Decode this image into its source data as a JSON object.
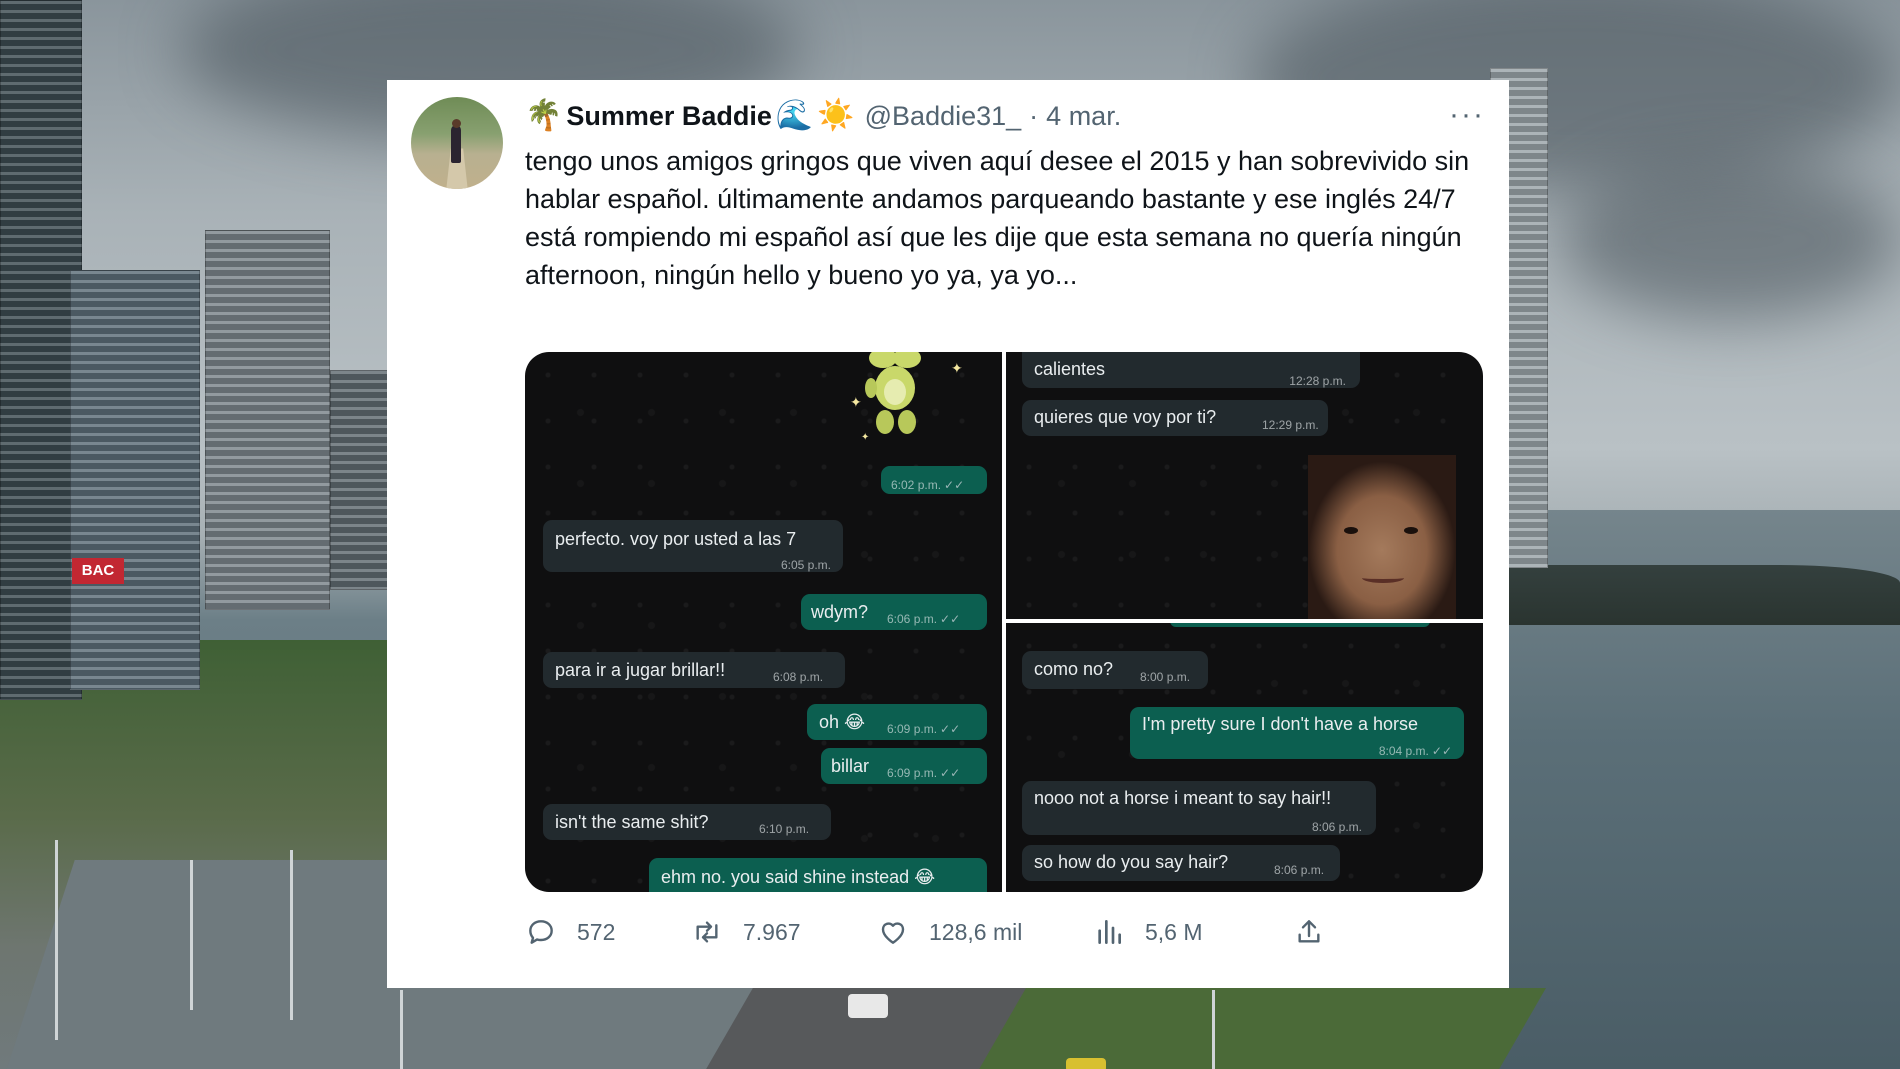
{
  "background": {
    "bank_sign": "BAC"
  },
  "tweet": {
    "display_name": "Summer Baddie",
    "emoji_prefix": "🌴",
    "emoji_suffix_1": "🌊",
    "emoji_suffix_2": "☀️",
    "handle": "@Baddie31_",
    "separator": "·",
    "date": "4 mar.",
    "more_label": "···",
    "text": "tengo unos amigos gringos que viven aquí desee el 2015 y han sobrevivido sin hablar español. últimamente andamos parqueando bastante y ese inglés 24/7 está rompiendo mi español así que les dije que esta semana no quería ningún afternoon, ningún hello y bueno yo ya, ya yo..."
  },
  "chat_panels": {
    "panel1": [
      {
        "dir": "out",
        "text": "",
        "time": "6:02 p.m.",
        "ticks": "✓✓"
      },
      {
        "dir": "in",
        "text": "perfecto. voy por usted a las 7",
        "time": "6:05 p.m."
      },
      {
        "dir": "out",
        "text": "wdym?",
        "time": "6:06 p.m.",
        "ticks": "✓✓"
      },
      {
        "dir": "in",
        "text": "para ir a jugar brillar!!",
        "time": "6:08 p.m."
      },
      {
        "dir": "out",
        "text": "oh 😂",
        "time": "6:09 p.m.",
        "ticks": "✓✓"
      },
      {
        "dir": "out",
        "text": "billar",
        "time": "6:09 p.m.",
        "ticks": "✓✓"
      },
      {
        "dir": "in",
        "text": "isn't the same shit?",
        "time": "6:10 p.m."
      },
      {
        "dir": "out",
        "text": "ehm no. you said shine instead 😂",
        "time": ""
      }
    ],
    "panel2": [
      {
        "dir": "in",
        "text": "calientes",
        "time": "12:28 p.m."
      },
      {
        "dir": "in",
        "text": "quieres que voy por ti?",
        "time": "12:29 p.m."
      }
    ],
    "panel3": [
      {
        "dir": "in",
        "text": "como no?",
        "time": "8:00 p.m."
      },
      {
        "dir": "out",
        "text": "I'm pretty sure I don't have a horse",
        "time": "8:04 p.m.",
        "ticks": "✓✓"
      },
      {
        "dir": "in",
        "text": "nooo not a horse i meant to say hair!!",
        "time": "8:06 p.m."
      },
      {
        "dir": "in",
        "text": "so how do you say hair?",
        "time": "8:06 p.m."
      }
    ]
  },
  "actions": {
    "replies": "572",
    "reposts": "7.967",
    "likes": "128,6 mil",
    "views": "5,6 M"
  },
  "icons": {
    "reply": "speech-bubble-icon",
    "repost": "repost-arrows-icon",
    "like": "heart-icon",
    "views": "bar-chart-icon",
    "share": "share-upload-icon"
  },
  "colors": {
    "text_primary": "#0f1419",
    "text_secondary": "#536471",
    "chat_bg": "#0f0f10",
    "bubble_in": "#222a2e",
    "bubble_out": "#0c5f50"
  }
}
